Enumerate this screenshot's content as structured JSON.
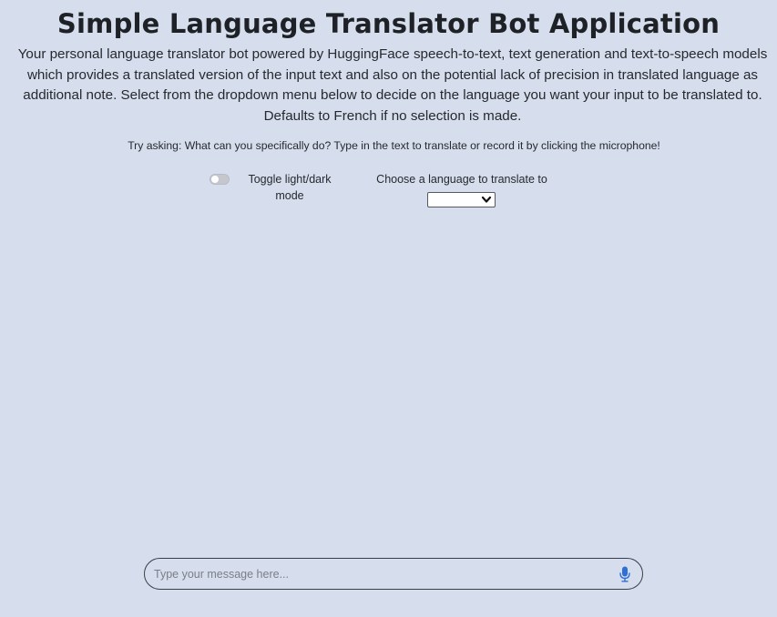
{
  "header": {
    "title": "Simple Language Translator Bot Application",
    "description": "Your personal language translator bot powered by HuggingFace speech-to-text, text generation and text-to-speech models which provides a translated version of the input text and also on the potential lack of precision in translated language as additional note. Select from the dropdown menu below to decide on the language you want your input to be translated to. Defaults to French if no selection is made.",
    "hint": "Try asking: What can you specifically do? Type in the text to translate or record it by clicking the microphone!"
  },
  "controls": {
    "toggle_label": "Toggle light/dark mode",
    "toggle_on": false,
    "language_label": "Choose a language to translate to",
    "language_selected": ""
  },
  "chat_input": {
    "placeholder": "Type your message here..."
  },
  "colors": {
    "background": "#d6deee",
    "mic_accent": "#2f6fd6"
  },
  "icons": {
    "toggle": "toggle-switch-icon",
    "dropdown": "chevron-down-icon",
    "microphone": "microphone-icon"
  }
}
